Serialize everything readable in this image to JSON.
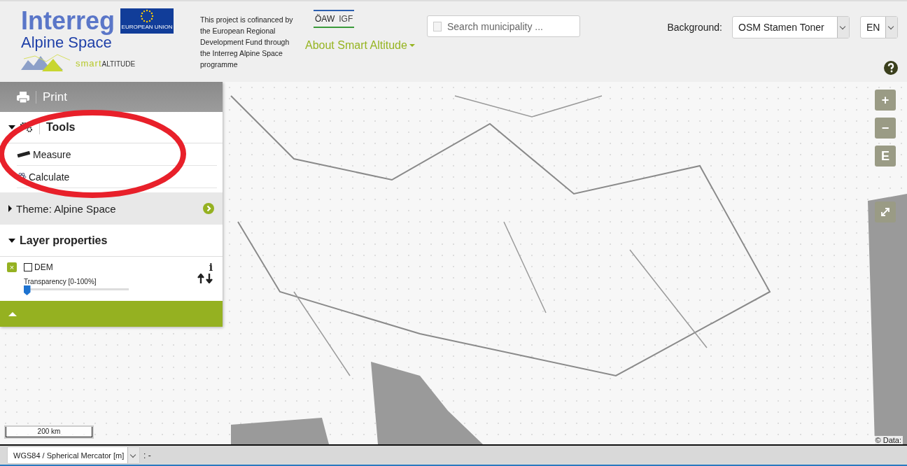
{
  "header": {
    "logo_title": "Interreg",
    "logo_subtitle": "Alpine Space",
    "eu_label": "EUROPEAN UNION",
    "project_logo": {
      "prefix": "smart",
      "suffix": "ALTITUDE"
    },
    "funding_text": "This project is cofinanced by the European Regional Development Fund through the Interreg Alpine Space programme",
    "partner_logo": {
      "left": "ÖAW",
      "right": "IGF"
    },
    "about_menu": "About Smart Altitude",
    "search": {
      "placeholder": "Search municipality ..."
    },
    "background": {
      "label": "Background:",
      "value": "OSM Stamen Toner"
    },
    "language": {
      "value": "EN"
    }
  },
  "panel": {
    "print": "Print",
    "sections": [
      {
        "kind": "tools",
        "title": "Tools",
        "expanded": true,
        "items": [
          {
            "kind": "measure",
            "label": "Measure"
          },
          {
            "kind": "calculate",
            "label": "Calculate"
          }
        ]
      },
      {
        "kind": "theme",
        "title": "Theme: Alpine Space",
        "expanded": false
      },
      {
        "kind": "layers",
        "title": "Layer properties",
        "expanded": true,
        "layers": [
          {
            "remove_label": "×",
            "info_label": "i",
            "name": "DEM",
            "visible": false,
            "transparency_label": "Transparency [0-100%]",
            "level": 0.03
          }
        ]
      }
    ]
  },
  "map_controls": [
    {
      "kind": "text",
      "label": "+"
    },
    {
      "kind": "text",
      "label": "−"
    },
    {
      "kind": "text",
      "label": "E"
    },
    {
      "kind": "fullscreen"
    }
  ],
  "scale": "200 km",
  "attribution": "© Data:",
  "status_bar": {
    "projection": "WGS84 / Spherical Mercator [m]",
    "coordinates": ": -"
  }
}
